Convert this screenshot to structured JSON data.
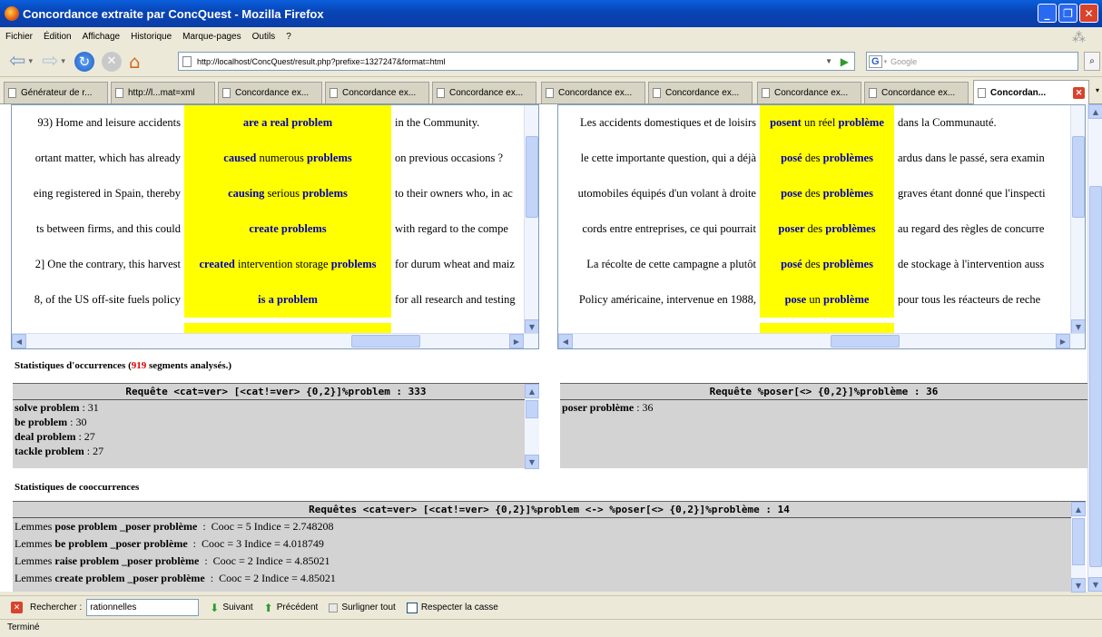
{
  "window": {
    "title": "Concordance extraite par ConcQuest - Mozilla Firefox"
  },
  "menu": [
    "Fichier",
    "Édition",
    "Affichage",
    "Historique",
    "Marque-pages",
    "Outils",
    "?"
  ],
  "nav": {
    "url": "http://localhost/ConcQuest/result.php?prefixe=1327247&format=html",
    "search_placeholder": "Google"
  },
  "tabs": [
    {
      "label": "Générateur de r..."
    },
    {
      "label": "http://l...mat=xml"
    },
    {
      "label": "Concordance ex..."
    },
    {
      "label": "Concordance ex..."
    },
    {
      "label": "Concordance ex..."
    },
    {
      "label": "Concordance ex..."
    },
    {
      "label": "Concordance ex..."
    },
    {
      "label": "Concordance ex..."
    },
    {
      "label": "Concordance ex..."
    },
    {
      "label": "Concordan..."
    }
  ],
  "conc_en": [
    {
      "left": "93) Home and leisure accidents",
      "kw": [
        [
          "are a real ",
          "b"
        ],
        [
          "problem",
          "b"
        ]
      ],
      "right": "in the Community."
    },
    {
      "left": "ortant matter, which has already",
      "kw": [
        [
          "caused ",
          "b"
        ],
        [
          "numerous ",
          "n"
        ],
        [
          "problems",
          "b"
        ]
      ],
      "right": "on previous occasions ?"
    },
    {
      "left": "eing registered in Spain, thereby",
      "kw": [
        [
          "causing ",
          "b"
        ],
        [
          "serious ",
          "n"
        ],
        [
          "problems",
          "b"
        ]
      ],
      "right": "to their owners who, in ac"
    },
    {
      "left": "ts between firms, and this could",
      "kw": [
        [
          "create problems",
          "b"
        ]
      ],
      "right": "with regard to the compe"
    },
    {
      "left": "2] One the contrary, this harvest",
      "kw": [
        [
          "created ",
          "b"
        ],
        [
          "intervention storage ",
          "n"
        ],
        [
          "problems",
          "b"
        ]
      ],
      "right": "for durum wheat and maiz"
    },
    {
      "left": "8, of the US off-site fuels policy",
      "kw": [
        [
          "is a problem",
          "b"
        ]
      ],
      "right": "for all research and testing"
    }
  ],
  "conc_fr": [
    {
      "left": "Les accidents domestiques et de loisirs",
      "kw": [
        [
          "posent ",
          "b"
        ],
        [
          "un réel ",
          "n"
        ],
        [
          "problème",
          "b"
        ]
      ],
      "right": "dans la Communauté."
    },
    {
      "left": "le cette importante question, qui a déjà",
      "kw": [
        [
          "posé ",
          "b"
        ],
        [
          "des ",
          "n"
        ],
        [
          "problèmes",
          "b"
        ]
      ],
      "right": "ardus dans le passé, sera examin"
    },
    {
      "left": "utomobiles équipés d'un volant à droite",
      "kw": [
        [
          "pose ",
          "b"
        ],
        [
          "des ",
          "n"
        ],
        [
          "problèmes",
          "b"
        ]
      ],
      "right": "graves étant donné que l'inspecti"
    },
    {
      "left": "cords entre entreprises, ce qui pourrait",
      "kw": [
        [
          "poser ",
          "b"
        ],
        [
          "des ",
          "n"
        ],
        [
          "problèmes",
          "b"
        ]
      ],
      "right": "au regard des règles de concurre"
    },
    {
      "left": "La récolte de cette campagne a plutôt",
      "kw": [
        [
          "posé ",
          "b"
        ],
        [
          "des ",
          "n"
        ],
        [
          "problèmes",
          "b"
        ]
      ],
      "right": "de stockage à l'intervention auss"
    },
    {
      "left": "Policy américaine, intervenue en 1988,",
      "kw": [
        [
          "pose ",
          "b"
        ],
        [
          "un ",
          "n"
        ],
        [
          "problème",
          "b"
        ]
      ],
      "right": "pour tous les réacteurs de reche"
    }
  ],
  "stats": {
    "heading_prefix": "Statistiques d'occurrences (",
    "segments": "919",
    "heading_suffix": " segments analysés.)",
    "left_header": "Requête <cat=ver> [<cat!=ver> {0,2}]%problem : 333",
    "left_items": [
      {
        "term": "solve problem",
        "count": " : 31"
      },
      {
        "term": "be problem",
        "count": " : 30"
      },
      {
        "term": "deal problem",
        "count": " : 27"
      },
      {
        "term": "tackle problem",
        "count": " : 27"
      }
    ],
    "right_header": "Requête %poser[<> {0,2}]%problème : 36",
    "right_items": [
      {
        "term": "poser problème",
        "count": " : 36"
      }
    ]
  },
  "cooc": {
    "heading": "Statistiques de cooccurrences",
    "header": "Requêtes <cat=ver> [<cat!=ver> {0,2}]%problem <-> %poser[<> {0,2}]%problème : 14",
    "items": [
      {
        "prefix": "Lemmes ",
        "pair": "pose problem _poser problème",
        "rest": "  :  Cooc = 5 Indice = 2.748208"
      },
      {
        "prefix": "Lemmes ",
        "pair": "be problem _poser problème",
        "rest": "  :  Cooc = 3 Indice = 4.018749"
      },
      {
        "prefix": "Lemmes ",
        "pair": "raise problem _poser problème",
        "rest": "  :  Cooc = 2 Indice = 4.85021"
      },
      {
        "prefix": "Lemmes ",
        "pair": "create problem _poser problème",
        "rest": "  :  Cooc = 2 Indice = 4.85021"
      }
    ]
  },
  "find": {
    "label": "Rechercher :",
    "value": "rationnelles",
    "next": "Suivant",
    "prev": "Précédent",
    "highlight": "Surligner tout",
    "matchcase": "Respecter la casse"
  },
  "status": "Terminé",
  "colors": {
    "keyword_bg": "#ffff00",
    "keyword_fg": "#0000b0",
    "count_red": "#e00000"
  }
}
